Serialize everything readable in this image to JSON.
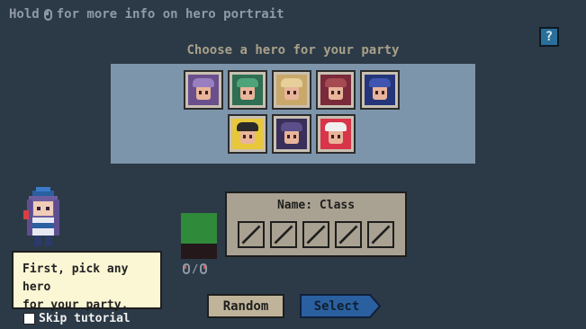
{
  "hint": {
    "prefix": "Hold",
    "suffix": "for more info on hero portrait",
    "icon": "mouse-icon"
  },
  "help_label": "?",
  "title": "Choose a hero for your party",
  "heroes": [
    {
      "hair": "#6a4f8c",
      "accent": "#9a7fc0"
    },
    {
      "hair": "#2f6e52",
      "accent": "#4fa37a"
    },
    {
      "hair": "#c9a86a",
      "accent": "#e6cf98"
    },
    {
      "hair": "#7a2a3a",
      "accent": "#a64a52"
    },
    {
      "hair": "#24357a",
      "accent": "#3e56b0"
    },
    {
      "hair": "#e8c83a",
      "accent": "#2a2a2a"
    },
    {
      "hair": "#3a2f5a",
      "accent": "#5a4f8a"
    },
    {
      "hair": "#d8354a",
      "accent": "#f0f0f0"
    }
  ],
  "tutorial_text": [
    "First, pick any hero",
    "for your party."
  ],
  "skip_label": "Skip tutorial",
  "swatch_colors": {
    "top": "#2f8a3a",
    "bottom": "#24181a"
  },
  "mice_separator": "/",
  "info": {
    "title": "Name: Class",
    "slots": 5
  },
  "random_label": "Random",
  "select_label": "Select",
  "colors": {
    "background": "#2c3a47",
    "panel": "#7d95ab",
    "select": "#2a5fa0",
    "accent_text": "#a8a08a"
  }
}
